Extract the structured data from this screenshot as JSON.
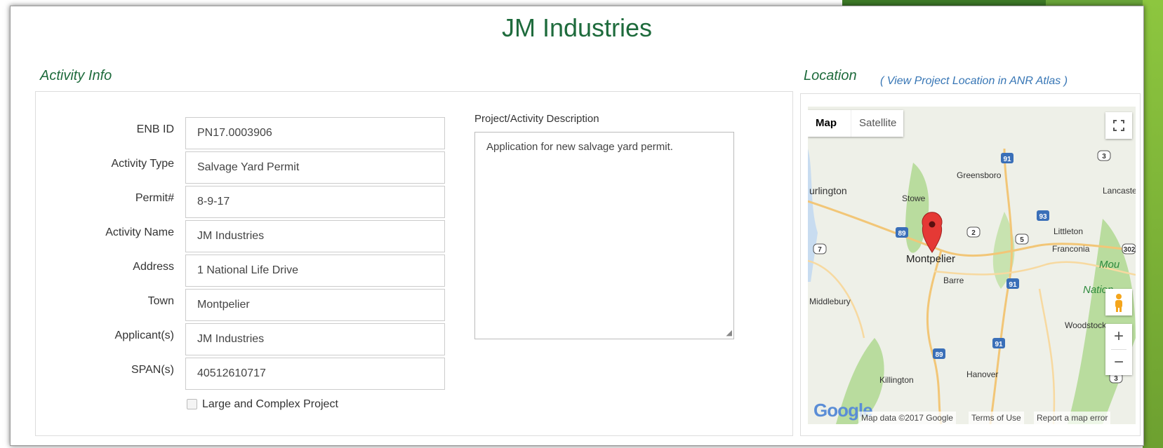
{
  "page": {
    "title": "JM Industries"
  },
  "activity": {
    "heading": "Activity Info",
    "fields": [
      {
        "label": "ENB ID",
        "value": "PN17.0003906"
      },
      {
        "label": "Activity Type",
        "value": "Salvage Yard Permit"
      },
      {
        "label": "Permit#",
        "value": "8-9-17"
      },
      {
        "label": "Activity Name",
        "value": "JM Industries"
      },
      {
        "label": "Address",
        "value": "1 National Life Drive"
      },
      {
        "label": "Town",
        "value": "Montpelier"
      },
      {
        "label": "Applicant(s)",
        "value": "JM Industries"
      },
      {
        "label": "SPAN(s)",
        "value": "40512610717"
      }
    ],
    "description_label": "Project/Activity Description",
    "description": "Application for new salvage yard permit.",
    "large_complex_label": "Large and Complex Project",
    "large_complex_checked": false
  },
  "location": {
    "heading": "Location",
    "atlas_link": "( View Project Location in ANR Atlas )"
  },
  "map": {
    "tabs": [
      "Map",
      "Satellite"
    ],
    "active_tab": "Map",
    "places": [
      "Burlington",
      "Stowe",
      "Greensboro",
      "Lancaster",
      "Montpelier",
      "Barre",
      "Littleton",
      "Franconia",
      "Middlebury",
      "Woodstock",
      "Hanover",
      "Killington"
    ],
    "place_labels": {
      "burlington": "urlington",
      "lancaster": "Lancaste",
      "white_mountain": "Mou",
      "national": "Nation",
      "hanover": "Hanover",
      "killington": "Killington"
    },
    "road_shields": {
      "i91_a": "91",
      "i91_b": "91",
      "i91_c": "91",
      "i89_a": "89",
      "i89_b": "89",
      "i93": "93",
      "us2": "2",
      "us5": "5",
      "us7": "7",
      "us3a": "3",
      "us3b": "3",
      "us302": "302",
      "us2_top": "2"
    },
    "zoom_in": "+",
    "zoom_out": "−",
    "footer": {
      "data": "Map data ©2017 Google",
      "terms": "Terms of Use",
      "report": "Report a map error"
    },
    "google": "Google"
  },
  "colors": {
    "heading": "#1e6b3c",
    "link": "#3776b5",
    "accent": "#8dc63f"
  }
}
